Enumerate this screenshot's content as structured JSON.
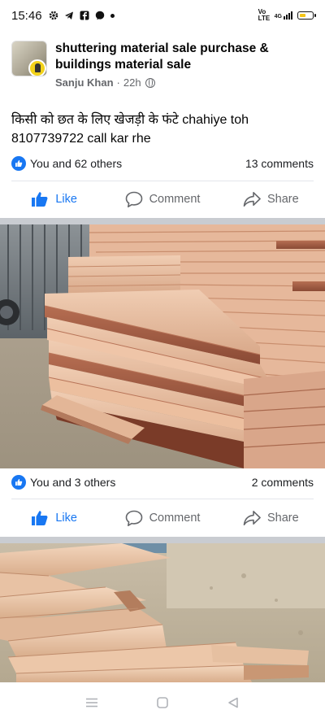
{
  "status_bar": {
    "time": "15:46",
    "left_icons": [
      "settings-gear-icon",
      "telegram-icon",
      "facebook-icon",
      "messenger-icon",
      "notification-dot"
    ],
    "right_icons": [
      "volte-icon",
      "signal-4g-icon",
      "battery-icon"
    ],
    "volte_text": "Vo LTE",
    "network_text": "4G"
  },
  "post": {
    "group_name": "shuttering material sale purchase & buildings  material  sale",
    "author": "Sanju Khan",
    "time": "22h",
    "separator": "·",
    "privacy_icon": "globe-icon",
    "text_line1": "किसी को छत के लिए खेजड़ी के फंटे chahiye toh",
    "text_line2": "8107739722 call kar rhe",
    "reactions_text": "You and 62 others",
    "comments_text": "13 comments"
  },
  "photo1": {
    "reactions_text": "You and 3 others",
    "comments_text": "2 comments"
  },
  "actions": {
    "like": "Like",
    "comment": "Comment",
    "share": "Share"
  },
  "colors": {
    "accent": "#1877f2",
    "secondary_text": "#65676b",
    "divider": "#e4e6eb",
    "separator_band": "#c9ccd1"
  },
  "nav_bar": {
    "icons": [
      "menu-icon",
      "home-square-icon",
      "back-triangle-icon"
    ]
  }
}
